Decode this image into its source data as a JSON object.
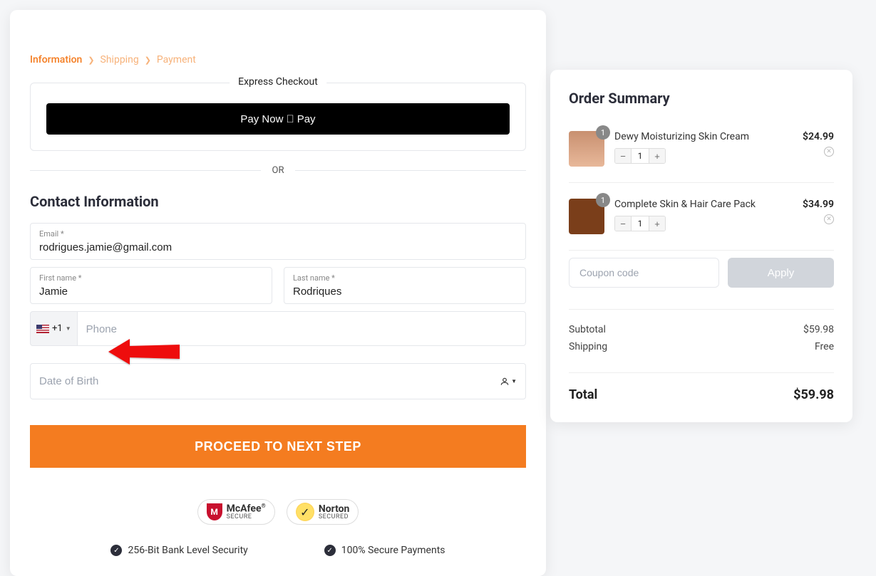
{
  "breadcrumb": {
    "steps": [
      "Information",
      "Shipping",
      "Payment"
    ],
    "active_index": 0
  },
  "express": {
    "title": "Express Checkout",
    "paynow_label": "Pay Now",
    "paynow_suffix": "Pay"
  },
  "or_text": "OR",
  "contact": {
    "title": "Contact Information",
    "email_label": "Email *",
    "email_value": "rodrigues.jamie@gmail.com",
    "first_name_label": "First name *",
    "first_name_value": "Jamie",
    "last_name_label": "Last name *",
    "last_name_value": "Rodriques",
    "country_code": "+1",
    "phone_placeholder": "Phone",
    "phone_value": "",
    "dob_placeholder": "Date of Birth",
    "dob_value": ""
  },
  "proceed_label": "PROCEED TO NEXT STEP",
  "trust": {
    "mcafee": {
      "line1": "McAfee",
      "line2": "SECURE",
      "reg": "®"
    },
    "norton": {
      "line1": "Norton",
      "line2": "SECURED"
    },
    "security1": "256-Bit Bank Level Security",
    "security2": "100% Secure Payments"
  },
  "order": {
    "title": "Order Summary",
    "items": [
      {
        "name": "Dewy Moisturizing Skin Cream",
        "price": "$24.99",
        "qty": "1",
        "badge": "1"
      },
      {
        "name": "Complete Skin & Hair Care Pack",
        "price": "$34.99",
        "qty": "1",
        "badge": "1"
      }
    ],
    "coupon_placeholder": "Coupon code",
    "apply_label": "Apply",
    "subtotal_label": "Subtotal",
    "subtotal_value": "$59.98",
    "shipping_label": "Shipping",
    "shipping_value": "Free",
    "total_label": "Total",
    "total_value": "$59.98"
  }
}
